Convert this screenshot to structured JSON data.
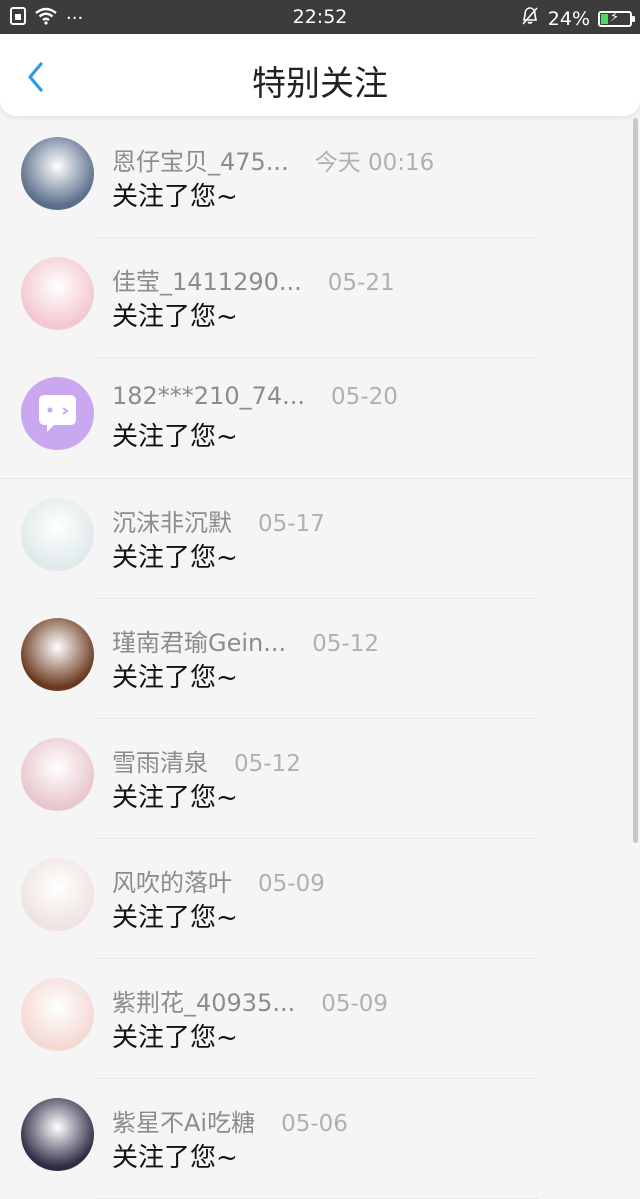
{
  "status": {
    "time": "22:52",
    "battery": "24%",
    "battery_level": 0.24,
    "signal_dots": "···"
  },
  "header": {
    "title": "特别关注",
    "back_icon": "chevron-left-icon",
    "accent": "#2a9bea"
  },
  "items": [
    {
      "name": "恩仔宝贝_475...",
      "time": "今天 00:16",
      "message": "关注了您~",
      "avatar_color": "#5a6d8a"
    },
    {
      "name": "佳莹_1411290...",
      "time": "05-21",
      "message": "关注了您~",
      "avatar_color": "#f3c7cf"
    },
    {
      "name": "182***210_74...",
      "time": "05-20",
      "message": "关注了您~",
      "avatar_color": "#c9a8f0"
    },
    {
      "name": "沉沫非沉默",
      "time": "05-17",
      "message": "关注了您~",
      "avatar_color": "#dfe9ea"
    },
    {
      "name": "瑾南君瑜Gein...",
      "time": "05-12",
      "message": "关注了您~",
      "avatar_color": "#6b3a1e"
    },
    {
      "name": "雪雨清泉",
      "time": "05-12",
      "message": "关注了您~",
      "avatar_color": "#e8c6cc"
    },
    {
      "name": "风吹的落叶",
      "time": "05-09",
      "message": "关注了您~",
      "avatar_color": "#efe3e0"
    },
    {
      "name": "紫荆花_40935...",
      "time": "05-09",
      "message": "关注了您~",
      "avatar_color": "#f4d9d3"
    },
    {
      "name": "紫星不Ai吃糖",
      "time": "05-06",
      "message": "关注了您~",
      "avatar_color": "#2e2b45"
    }
  ]
}
